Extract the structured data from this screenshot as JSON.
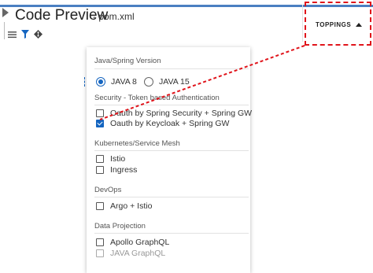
{
  "header": {
    "title": "Code Preview",
    "subtitle": "- pom.xml",
    "toppings_label": "TOPPINGS"
  },
  "icons": [
    "collapse-icon",
    "list-icon",
    "filter-icon",
    "git-icon",
    "caret-up-icon"
  ],
  "colors": {
    "accent": "#1565c0",
    "top_rule": "#4a7fc1",
    "highlight": "#e0141b"
  },
  "panel": {
    "java": {
      "heading": "Java/Spring Version",
      "options": [
        {
          "label": "JAVA 8",
          "selected": true
        },
        {
          "label": "JAVA 15",
          "selected": false
        }
      ]
    },
    "security": {
      "heading": "Security - Token based Authentication",
      "options": [
        {
          "label": "Oauth by Spring Security + Spring GW",
          "checked": false
        },
        {
          "label": "Oauth by Keycloak + Spring GW",
          "checked": true
        }
      ]
    },
    "kubernetes": {
      "heading": "Kubernetes/Service Mesh",
      "options": [
        {
          "label": "Istio",
          "checked": false
        },
        {
          "label": "Ingress",
          "checked": false
        }
      ]
    },
    "devops": {
      "heading": "DevOps",
      "options": [
        {
          "label": "Argo + Istio",
          "checked": false
        }
      ]
    },
    "projection": {
      "heading": "Data Projection",
      "options": [
        {
          "label": "Apollo GraphQL",
          "checked": false,
          "disabled": false
        },
        {
          "label": "JAVA GraphQL",
          "checked": false,
          "disabled": true
        }
      ]
    }
  }
}
